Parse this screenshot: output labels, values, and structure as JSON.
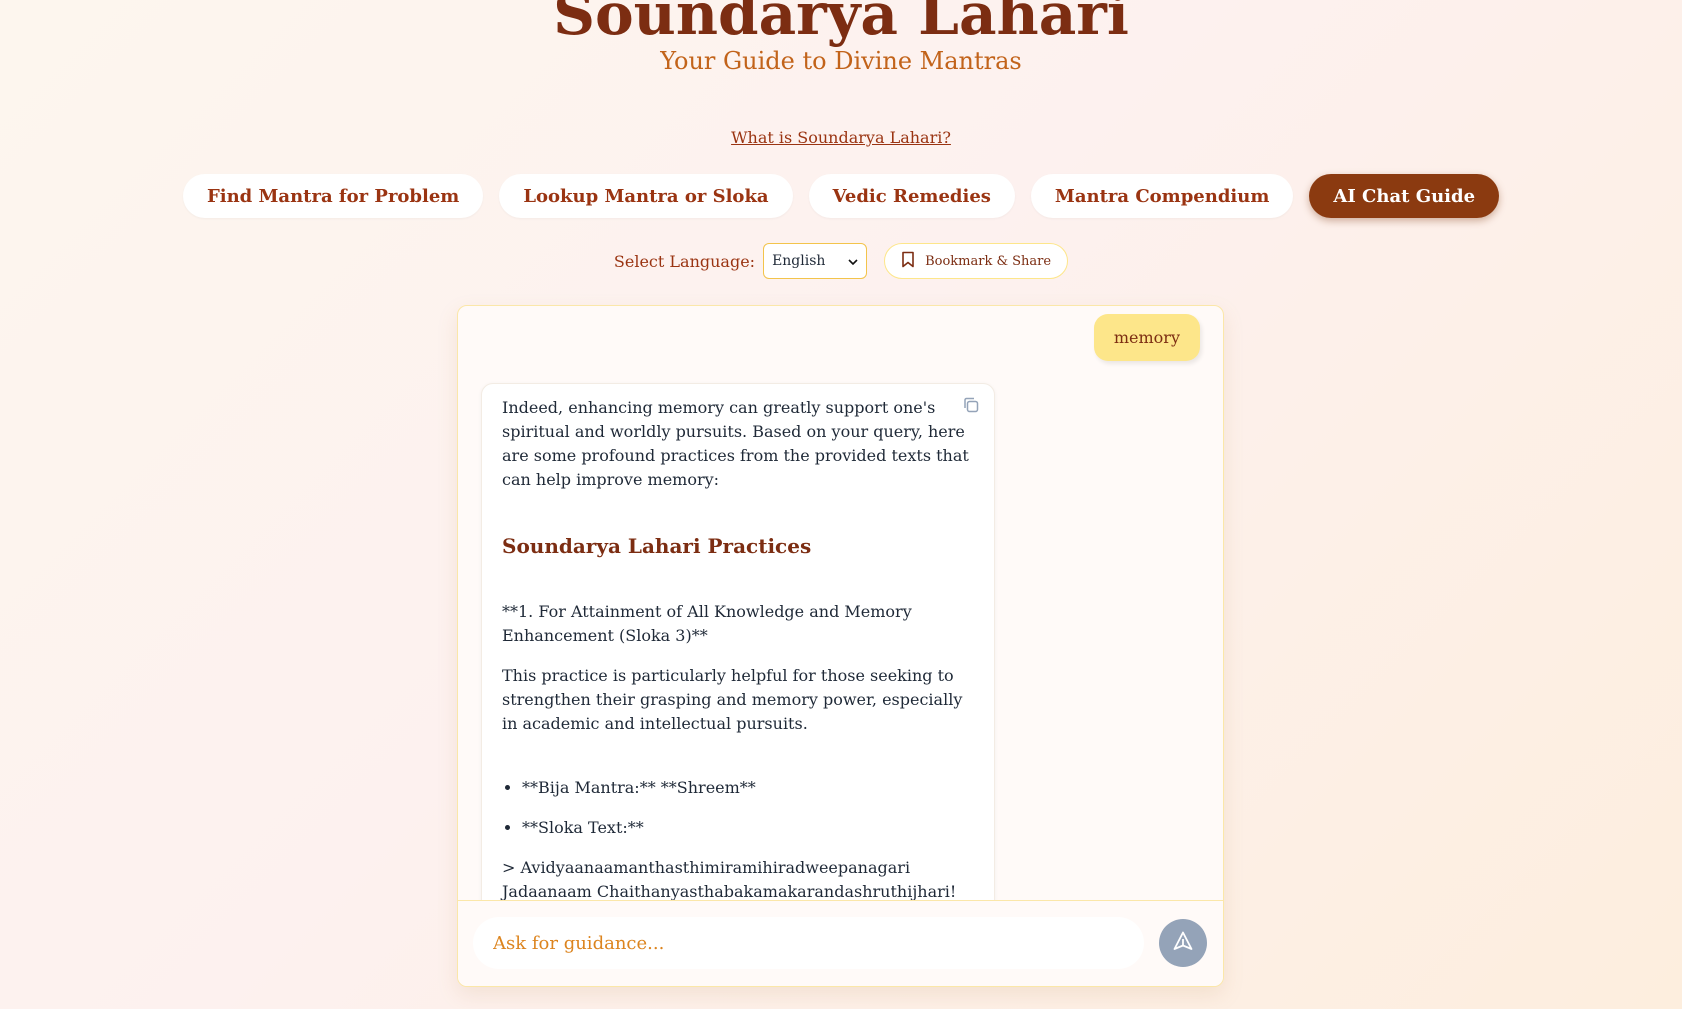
{
  "header": {
    "title": "Soundarya Lahari",
    "subtitle": "Your Guide to Divine Mantras",
    "about_link": "What is Soundarya Lahari?"
  },
  "nav": {
    "tabs": [
      {
        "label": "Find Mantra for Problem",
        "active": false
      },
      {
        "label": "Lookup Mantra or Sloka",
        "active": false
      },
      {
        "label": "Vedic Remedies",
        "active": false
      },
      {
        "label": "Mantra Compendium",
        "active": false
      },
      {
        "label": "AI Chat Guide",
        "active": true
      }
    ]
  },
  "controls": {
    "language_label": "Select Language:",
    "language_value": "English",
    "bookmark_label": "Bookmark & Share"
  },
  "chat": {
    "user_message": "memory",
    "bot": {
      "intro": "Indeed, enhancing memory can greatly support one's spiritual and worldly pursuits. Based on your query, here are some profound practices from the provided texts that can help improve memory:",
      "heading": "Soundarya Lahari Practices",
      "item_title": "**1. For Attainment of All Knowledge and Memory Enhancement (Sloka 3)**",
      "item_desc": "This practice is particularly helpful for those seeking to strengthen their grasping and memory power, especially in academic and intellectual pursuits.",
      "bullets": [
        "**Bija Mantra:** **Shreem**",
        "**Sloka Text:**"
      ],
      "sloka_line1": "> Avidyaanaamanthasthimiramihiradweepanagari",
      "sloka_line2": "Jadaanaam Chaithanyasthabakamakarandashruthijhari!"
    },
    "input_placeholder": "Ask for guidance..."
  },
  "colors": {
    "brand": "#7c2d12",
    "active_tab": "#8b3a10",
    "accent_yellow": "#fde68a",
    "send_button": "#94a3b8"
  },
  "icons": {
    "copy": "copy-icon",
    "bookmark": "bookmark-icon",
    "send": "send-icon",
    "select": "chevron-down-icon"
  }
}
